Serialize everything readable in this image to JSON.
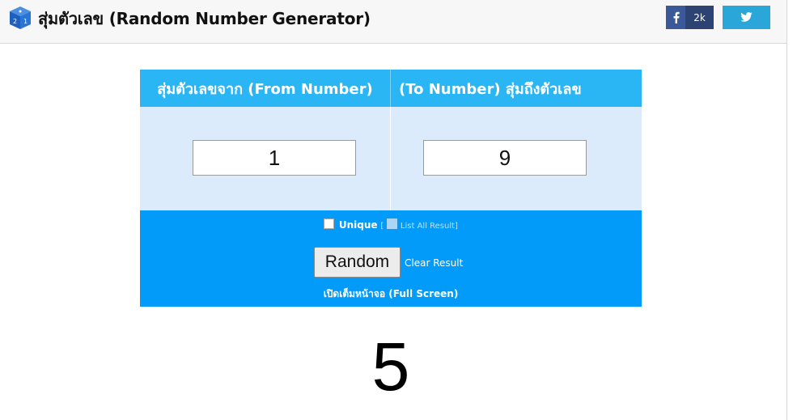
{
  "header": {
    "title": "สุ่มตัวเลข (Random Number Generator)",
    "logo_icon": "dice-icon",
    "facebook": {
      "icon": "facebook-icon",
      "count": "2k",
      "color": "#3b5998"
    },
    "twitter": {
      "icon": "twitter-icon",
      "color": "#2aa6d9"
    }
  },
  "form": {
    "from_label": "สุ่มตัวเลขจาก (From Number)",
    "to_label": "(To Number) สุ่มถึงตัวเลข",
    "from_value": "1",
    "to_value": "9",
    "unique_label": "Unique",
    "list_all_open": "[",
    "list_all_label": "List All Result]",
    "random_button": "Random",
    "clear_label": "Clear Result",
    "fullscreen_label": "เปิดเต็มหน้าจอ (Full Screen)"
  },
  "result": {
    "value": "5"
  },
  "colors": {
    "header_bg": "#2ab5f5",
    "input_bg": "#dcebfb",
    "controls_bg": "#039bf9"
  }
}
